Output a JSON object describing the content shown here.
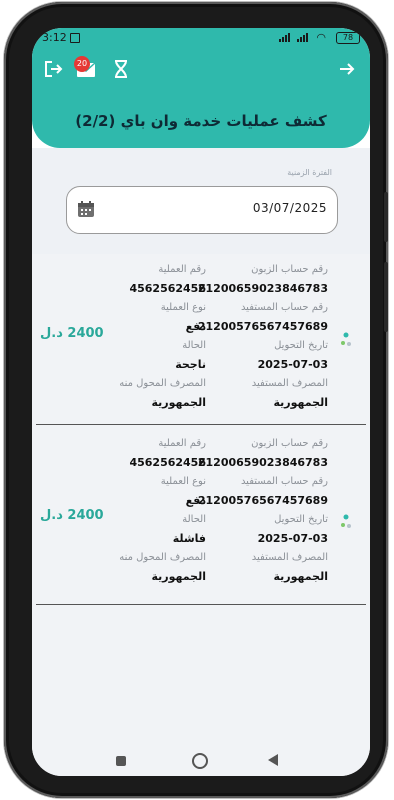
{
  "status": {
    "time": "3:12",
    "battery": "78"
  },
  "header": {
    "title": "كشف عمليات خدمة وان باي (2/2)",
    "badge_count": "20",
    "icons": [
      "logout-icon",
      "mail-icon",
      "hourglass-icon",
      "arrow-right-icon"
    ]
  },
  "filter": {
    "label": "الفترة الزمنية",
    "date_value": "03/07/2025"
  },
  "labels": {
    "customer_account": "رقم حساب الزبون",
    "operation_number": "رقم العملية",
    "beneficiary_account": "رقم حساب المستفيد",
    "operation_type": "نوع العملية",
    "transfer_date": "تاريخ التحويل",
    "status": "الحالة",
    "beneficiary_bank": "المصرف المستفيد",
    "source_bank": "المصرف المحول منه"
  },
  "transactions": [
    {
      "customer_account": "2120065902384678З",
      "operation_number": "4562562456",
      "beneficiary_account": "2120057656745768​9",
      "operation_type": "دفع",
      "transfer_date": "2025-07-03",
      "status": "ناجحة",
      "beneficiary_bank": "الجمهورية",
      "source_bank": "الجمهورية",
      "amount": "2400 د.ل"
    },
    {
      "customer_account": "21200659023846783",
      "operation_number": "4562562456",
      "beneficiary_account": "21200576567457689",
      "operation_type": "دفع",
      "transfer_date": "2025-07-03",
      "status": "فاشلة",
      "beneficiary_bank": "الجمهورية",
      "source_bank": "الجمهورية",
      "amount": "2400 د.ل"
    }
  ],
  "colors": {
    "accent": "#2fb9ac",
    "amount": "#2aa89a",
    "badge": "#e53935"
  }
}
